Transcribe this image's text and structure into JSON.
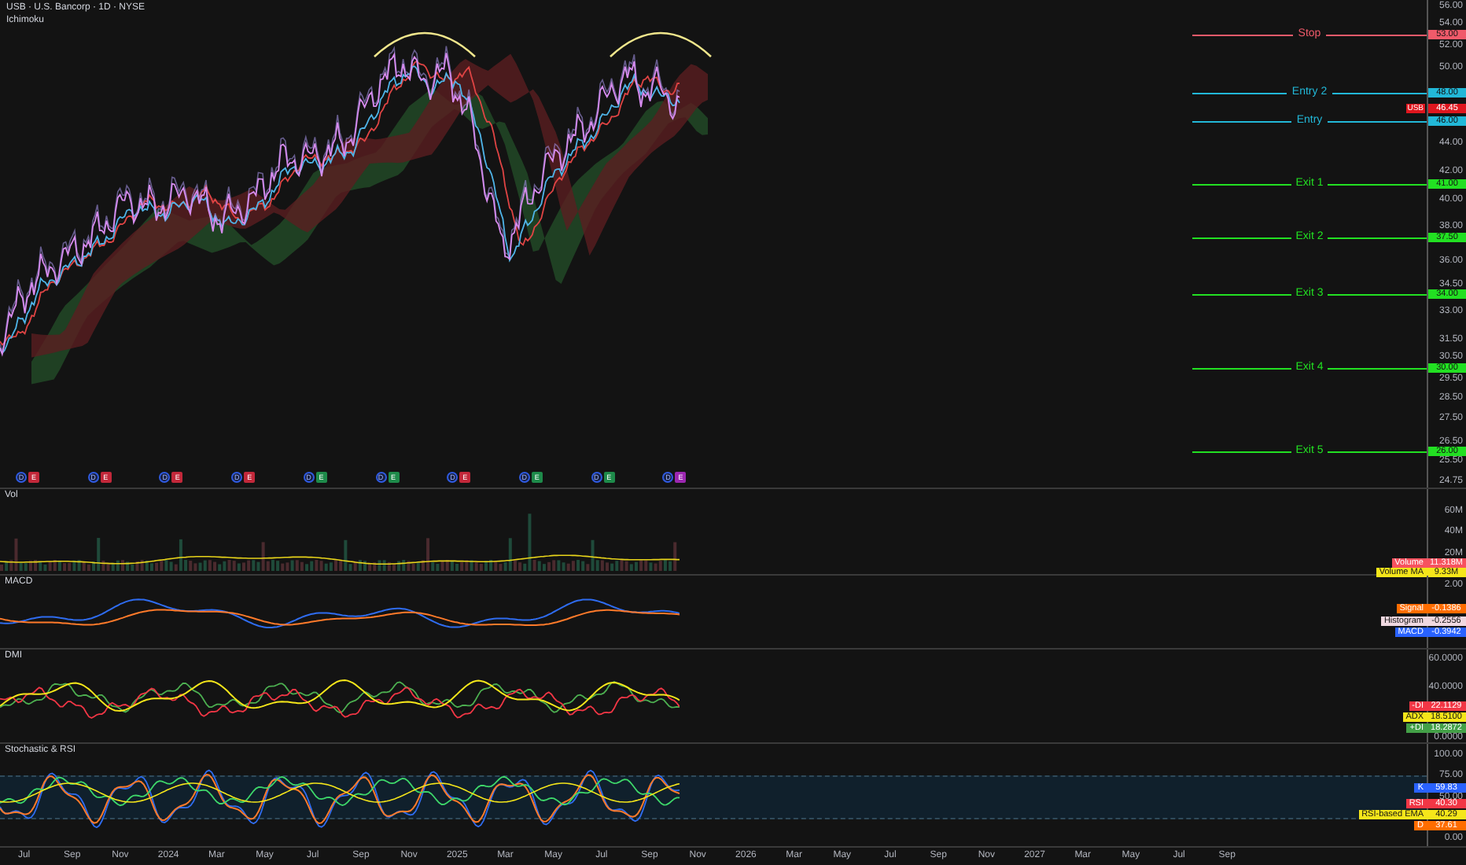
{
  "chart": {
    "title": "USB · U.S. Bancorp · 1D · NYSE",
    "indicator": "Ichimoku",
    "levels": [
      {
        "label": "Stop",
        "price": "53.00",
        "color": "#f05a6a"
      },
      {
        "label": "Entry 2",
        "price": "48.00",
        "color": "#22b8d8"
      },
      {
        "label": "Entry",
        "price": "46.00",
        "color": "#22b8d8"
      },
      {
        "label": "Exit 1",
        "price": "41.00",
        "color": "#22e022"
      },
      {
        "label": "Exit 2",
        "price": "37.50",
        "color": "#22e022"
      },
      {
        "label": "Exit 3",
        "price": "34.00",
        "color": "#22e022"
      },
      {
        "label": "Exit 4",
        "price": "30.00",
        "color": "#22e022"
      },
      {
        "label": "Exit 5",
        "price": "26.00",
        "color": "#22e022"
      }
    ],
    "last_price": {
      "symbol": "USB",
      "price": "46.45"
    },
    "price_ticks": [
      "56.00",
      "54.00",
      "52.00",
      "50.00",
      "44.00",
      "42.00",
      "40.00",
      "38.00",
      "36.00",
      "34.50",
      "33.00",
      "31.50",
      "30.50",
      "29.50",
      "28.50",
      "27.50",
      "26.50",
      "25.50",
      "24.75"
    ],
    "events": [
      {
        "dividend": "D",
        "earnings": "E",
        "color": "#c2283a"
      },
      {
        "dividend": "D",
        "earnings": "E",
        "color": "#c2283a"
      },
      {
        "dividend": "D",
        "earnings": "E",
        "color": "#c2283a"
      },
      {
        "dividend": "D",
        "earnings": "E",
        "color": "#c2283a"
      },
      {
        "dividend": "D",
        "earnings": "E",
        "color": "#1e8a4a"
      },
      {
        "dividend": "D",
        "earnings": "E",
        "color": "#1e8a4a"
      },
      {
        "dividend": "D",
        "earnings": "E",
        "color": "#c2283a"
      },
      {
        "dividend": "D",
        "earnings": "E",
        "color": "#1e8a4a"
      },
      {
        "dividend": "D",
        "earnings": "E",
        "color": "#1e8a4a"
      },
      {
        "dividend": "D",
        "earnings": "E",
        "color": "#9c27b0"
      }
    ]
  },
  "panes": [
    {
      "kind": "volume",
      "title": "Vol",
      "ticks": [
        "60M",
        "40M",
        "20M"
      ],
      "readouts": [
        {
          "name": "Volume",
          "value": "11.318M",
          "color": "#f7525f",
          "dark_text": false
        },
        {
          "name": "Volume MA",
          "value": "9.33M",
          "color": "#f5e61a",
          "dark_text": true
        }
      ]
    },
    {
      "kind": "macd",
      "title": "MACD",
      "ticks": [
        "2.00"
      ],
      "readouts": [
        {
          "name": "Signal",
          "value": "-0.1386",
          "color": "#ff6d00",
          "dark_text": false
        },
        {
          "name": "Histogram",
          "value": "-0.2556",
          "color": "#f0d8e0",
          "dark_text": true
        },
        {
          "name": "MACD",
          "value": "-0.3942",
          "color": "#2962ff",
          "dark_text": false
        }
      ]
    },
    {
      "kind": "dmi",
      "title": "DMI",
      "ticks": [
        "60.0000",
        "40.0000",
        "0.0000"
      ],
      "readouts": [
        {
          "name": "-DI",
          "value": "22.1129",
          "color": "#f23645",
          "dark_text": false
        },
        {
          "name": "ADX",
          "value": "18.5100",
          "color": "#f5e61a",
          "dark_text": true
        },
        {
          "name": "+DI",
          "value": "18.2872",
          "color": "#43a047",
          "dark_text": false
        }
      ]
    },
    {
      "kind": "stochastic",
      "title": "Stochastic & RSI",
      "ticks": [
        "100.00",
        "75.00",
        "50.00",
        "0.00"
      ],
      "readouts": [
        {
          "name": "K",
          "value": "59.83",
          "color": "#2962ff",
          "dark_text": false
        },
        {
          "name": "RSI",
          "value": "40.30",
          "color": "#f23645",
          "dark_text": false
        },
        {
          "name": "RSI-based EMA",
          "value": "40.29",
          "color": "#f5e61a",
          "dark_text": true
        },
        {
          "name": "D",
          "value": "37.61",
          "color": "#ff6d00",
          "dark_text": false
        }
      ]
    }
  ],
  "time_axis": [
    "Jul",
    "Sep",
    "Nov",
    "2024",
    "Mar",
    "May",
    "Jul",
    "Sep",
    "Nov",
    "2025",
    "Mar",
    "May",
    "Jul",
    "Sep",
    "Nov",
    "2026",
    "Mar",
    "May",
    "Jul",
    "Sep",
    "Nov",
    "2027",
    "Mar",
    "May",
    "Jul",
    "Sep"
  ]
}
